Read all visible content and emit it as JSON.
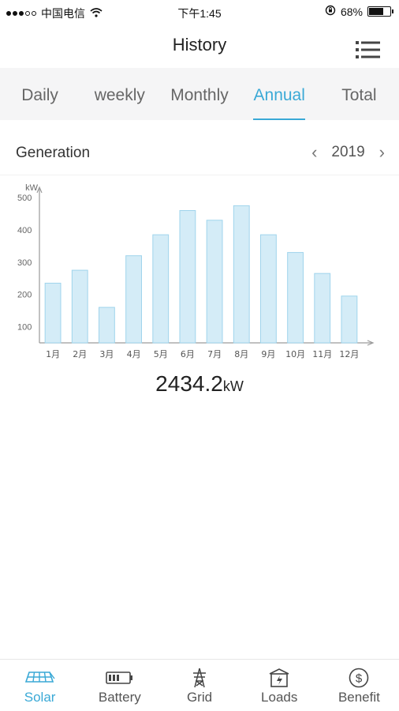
{
  "status_bar": {
    "carrier": "中国电信",
    "time": "下午1:45",
    "battery_pct": "68%",
    "battery_level": 0.68
  },
  "header": {
    "title": "History"
  },
  "tabs": [
    {
      "label": "Daily",
      "active": false
    },
    {
      "label": "weekly",
      "active": false
    },
    {
      "label": "Monthly",
      "active": false
    },
    {
      "label": "Annual",
      "active": true
    },
    {
      "label": "Total",
      "active": false
    }
  ],
  "generation": {
    "label": "Generation",
    "year": "2019",
    "prev_icon": "chevron-left-icon",
    "next_icon": "chevron-right-icon"
  },
  "chart_data": {
    "type": "bar",
    "categories": [
      "1月",
      "2月",
      "3月",
      "4月",
      "5月",
      "6月",
      "7月",
      "8月",
      "9月",
      "10月",
      "11月",
      "12月"
    ],
    "values": [
      235,
      275,
      160,
      320,
      385,
      460,
      430,
      475,
      385,
      330,
      265,
      195
    ],
    "ylabel": "kW",
    "yticks": [
      100,
      200,
      300,
      400,
      500
    ],
    "ylim": [
      50,
      520
    ],
    "bar_color": "#d4ecf7",
    "bar_stroke": "#9fd4ec",
    "grid": false
  },
  "total": {
    "value": "2434.2",
    "unit": "kW"
  },
  "bottom_nav": [
    {
      "label": "Solar",
      "icon": "solar-panel-icon",
      "active": true
    },
    {
      "label": "Battery",
      "icon": "battery-icon",
      "active": false
    },
    {
      "label": "Grid",
      "icon": "power-tower-icon",
      "active": false
    },
    {
      "label": "Loads",
      "icon": "loads-icon",
      "active": false
    },
    {
      "label": "Benefit",
      "icon": "dollar-icon",
      "active": false
    }
  ],
  "colors": {
    "accent": "#3aa9d6"
  }
}
